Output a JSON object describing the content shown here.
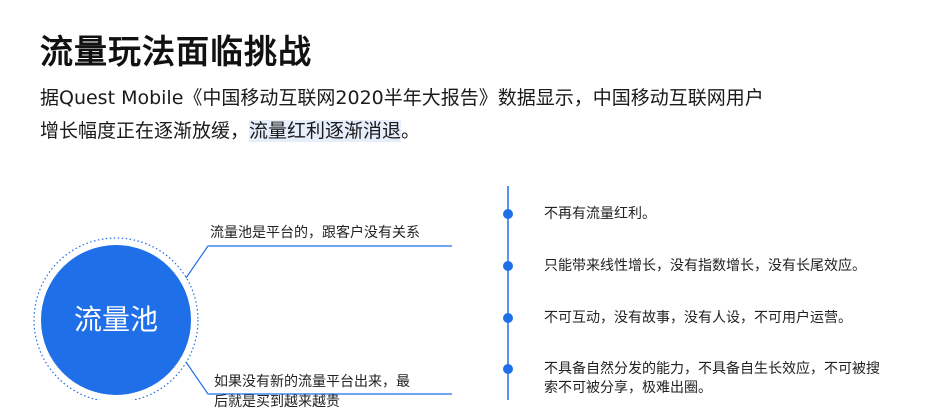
{
  "title": "流量玩法面临挑战",
  "paragraph": {
    "line1": "据Quest Mobile《中国移动互联网2020半年大报告》数据显示，中国移动互联网用户",
    "line2_plain": "增长幅度正在逐渐放缓，",
    "line2_highlight": "流量红利逐渐消退",
    "line2_end": "。"
  },
  "diagram": {
    "circle_label": "流量池",
    "branch_top": "流量池是平台的，跟客户没有关系",
    "branch_bottom": "如果没有新的流量平台出来，最",
    "branch_bottom_partial": "后就是买到越来越贵",
    "timeline": [
      "不再有流量红利。",
      "只能带来线性增长，没有指数增长，没有长尾效应。",
      "不可互动，没有故事，没有人设，不可用户运营。",
      "不具备自然分发的能力，不具备自生长效应，不可被搜",
      "索不可被分享，极难出圈。"
    ]
  },
  "colors": {
    "accent": "#1f6fe8",
    "highlight": "#e6eefb"
  }
}
